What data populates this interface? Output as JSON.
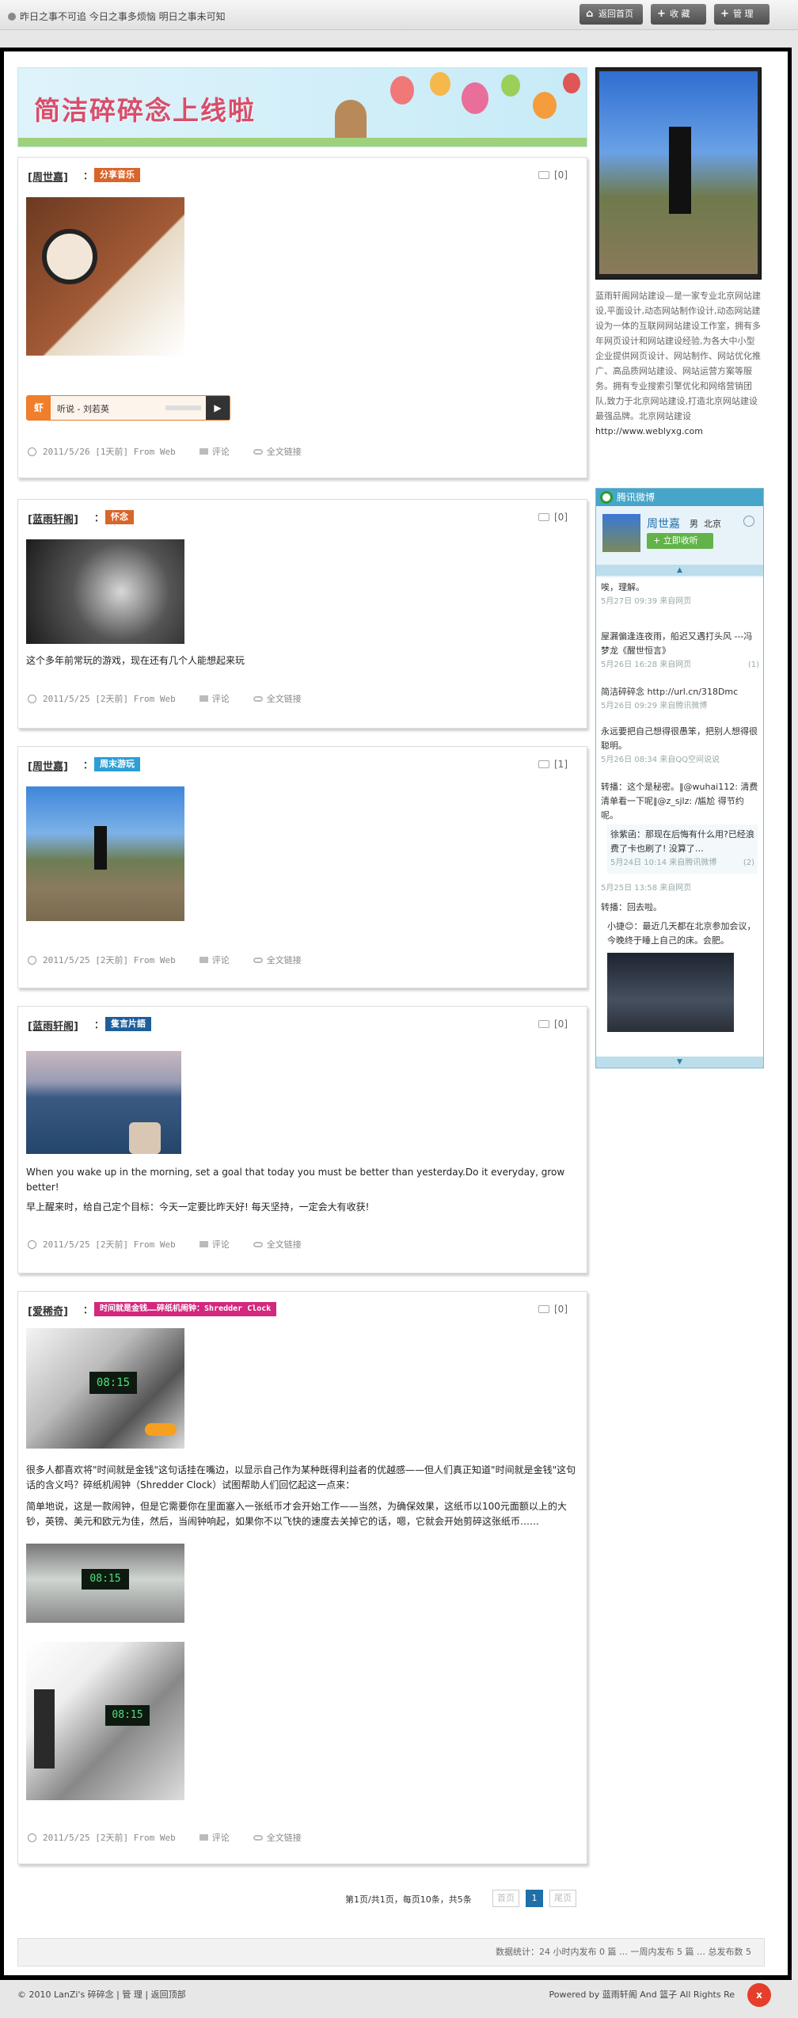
{
  "topbar": {
    "motto": "昨日之事不可追  今日之事多烦恼  明日之事未可知",
    "buttons": [
      "返回首页",
      "收 藏",
      "管 理"
    ]
  },
  "banner": {
    "title": "简洁碎碎念上线啦"
  },
  "posts": [
    {
      "author": "[周世嘉]",
      "colon": "：",
      "tag": "分享音乐",
      "tag_color": "#d9652a",
      "comments": "[0]",
      "player_label": "听说 - 刘若英",
      "date": "2011/5/26",
      "ago": "[1天前]",
      "from": "From Web",
      "comment_link": "评论",
      "full_link": "全文链接"
    },
    {
      "author": "[蓝雨轩阁]",
      "colon": "：",
      "tag": "怀念",
      "tag_color": "#d9652a",
      "comments": "[0]",
      "text": "这个多年前常玩的游戏，现在还有几个人能想起来玩",
      "date": "2011/5/25",
      "ago": "[2天前]",
      "from": "From Web",
      "comment_link": "评论",
      "full_link": "全文链接"
    },
    {
      "author": "[周世嘉]",
      "colon": "：",
      "tag": "周末游玩",
      "tag_color": "#2b9fd6",
      "comments": "[1]",
      "date": "2011/5/25",
      "ago": "[2天前]",
      "from": "From Web",
      "comment_link": "评论",
      "full_link": "全文链接"
    },
    {
      "author": "[蓝雨轩阁]",
      "colon": "：",
      "tag": "隻言片語",
      "tag_color": "#1d5f9c",
      "comments": "[0]",
      "text": "When you wake up in the morning, set a goal that today you must be better than yesterday.Do it everyday, grow better!",
      "text2": "早上醒来时，给自己定个目标：今天一定要比昨天好! 每天坚持，一定会大有收获!",
      "date": "2011/5/25",
      "ago": "[2天前]",
      "from": "From Web",
      "comment_link": "评论",
      "full_link": "全文链接"
    },
    {
      "author": "[爱稀奇]",
      "colon": "：",
      "tag": "时间就是金钱……碎纸机闹钟：Shredder Clock",
      "tag_color": "#d4277e",
      "comments": "[0]",
      "para1": "    很多人都喜欢将\"时间就是金钱\"这句话挂在嘴边，以显示自己作为某种既得利益者的优越感——但人们真正知道\"时间就是金钱\"这句话的含义吗？碎纸机闹钟（Shredder Clock）试图帮助人们回忆起这一点来：",
      "para2": "    简单地说，这是一款闹钟，但是它需要你在里面塞入一张纸币才会开始工作——当然，为确保效果，这纸币以100元面额以上的大钞，英镑、美元和欧元为佳，然后，当闹钟响起，如果你不以飞快的速度去关掉它的话，嗯，它就会开始剪碎这张纸币……",
      "date": "2011/5/25",
      "ago": "[2天前]",
      "from": "From Web",
      "comment_link": "评论",
      "full_link": "全文链接"
    }
  ],
  "pager": {
    "summary": "第1页/共1页，每页10条，共5条",
    "prev": "首页",
    "current": "1",
    "next": "尾页"
  },
  "stats": "数据统计：24 小时内发布  0 篇 … 一周内发布  5 篇 … 总发布数  5",
  "footer": {
    "left": "© 2010 LanZi's 碎碎念  |  管 理  |  返回顶部",
    "right": "Powered by 蓝雨轩阁 And 篮子  All Rights Re"
  },
  "sidebar": {
    "desc": "蓝雨轩阁网站建设—是一家专业北京网站建设,平面设计,动态网站制作设计,动态网站建设为一体的互联网网站建设工作室，拥有多年网页设计和网站建设经验,为各大中小型企业提供网页设计、网站制作、网站优化推广、高品质网站建设、网站运营方案等服务。拥有专业搜索引擎优化和网络营销团队,致力于北京网站建设,打造北京网站建设最强品牌。北京网站建设",
    "link": "http://www.weblyxg.com"
  },
  "weibo": {
    "title": "腾讯微博",
    "user_name": "周世嘉",
    "gender": "男",
    "city": "北京",
    "listen_button": "+ 立即收听",
    "items": [
      {
        "text": "唉，理解。",
        "time": "5月27日 09:39 来自网页"
      },
      {
        "text": "屋漏偏逢连夜雨，船迟又遇打头风 ---冯梦龙《醒世恒言》",
        "time": "5月26日 16:28 来自网页",
        "count": "(1)"
      },
      {
        "text": "简洁碎碎念 http://url.cn/318Dmc",
        "time": "5月26日 09:29 来自腾讯微博"
      },
      {
        "text": "永远要把自己想得很愚笨，把别人想得很聪明。",
        "time": "5月26日 08:34 来自QQ空间说说"
      },
      {
        "text": "转播：这个是秘密。‖@wuhai112: 清费清单看一下呢‖@z_sjlz: /尴尬 得节约呢。",
        "time": ""
      },
      {
        "text": "徐紫函：那现在后悔有什么用?已经浪费了卡也刷了! 没算了…",
        "time": "5月24日 10:14 来自腾讯微博",
        "count": "(2)"
      },
      {
        "text": "",
        "time": "5月25日 13:58 来自网页"
      },
      {
        "text": "转播：回去啦。",
        "time": ""
      },
      {
        "text": "小捷😊：最近几天都在北京参加会议，今晚终于睡上自己的床。会肥。",
        "time": ""
      }
    ]
  },
  "colors": {
    "accent": "#1f6fa8",
    "frame": "#000000",
    "weibo": "#47a5c9"
  }
}
